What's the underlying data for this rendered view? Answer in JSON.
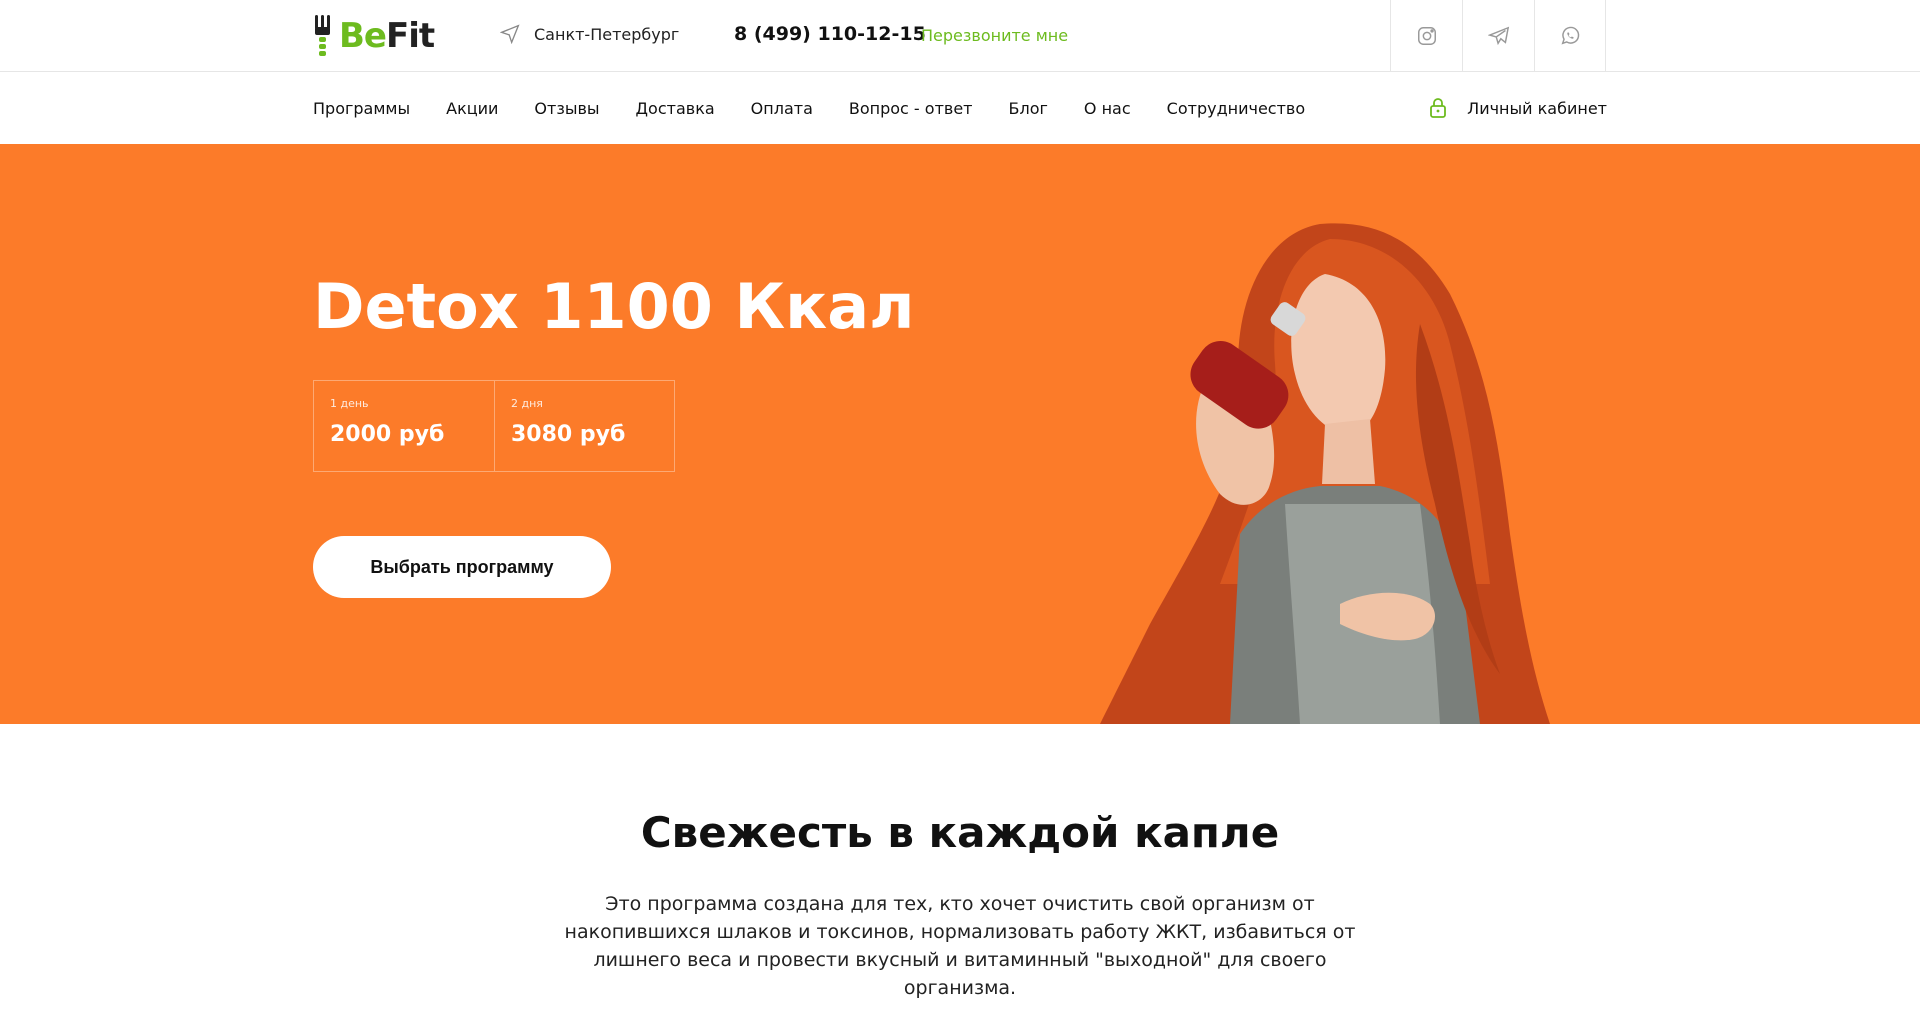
{
  "brand": {
    "logo_be": "Be",
    "logo_fit": "Fit"
  },
  "header": {
    "city": "Санкт-Петербург",
    "phone": "8 (499) 110-12-15",
    "callback_label": "Перезвоните мне",
    "socials": [
      "instagram-icon",
      "telegram-icon",
      "whatsapp-icon"
    ]
  },
  "nav": {
    "items": [
      "Программы",
      "Акции",
      "Отзывы",
      "Доставка",
      "Оплата",
      "Вопрос - ответ",
      "Блог",
      "О нас",
      "Сотрудничество"
    ],
    "account_label": "Личный кабинет"
  },
  "hero": {
    "title": "Detox 1100 Ккал",
    "prices": [
      {
        "label": "1 день",
        "value": "2000 руб"
      },
      {
        "label": "2 дня",
        "value": "3080 руб"
      }
    ],
    "cta_label": "Выбрать программу"
  },
  "section": {
    "title": "Свежесть в каждой капле",
    "text": "Это программа создана для тех, кто хочет очистить свой организм от накопившихся шлаков и токсинов, нормализовать работу ЖКТ, избавиться от лишнего веса и провести вкусный и витаминный \"выходной\" для своего организма."
  },
  "colors": {
    "accent": "#6dbb1f",
    "hero_bg": "#fc7b29"
  }
}
